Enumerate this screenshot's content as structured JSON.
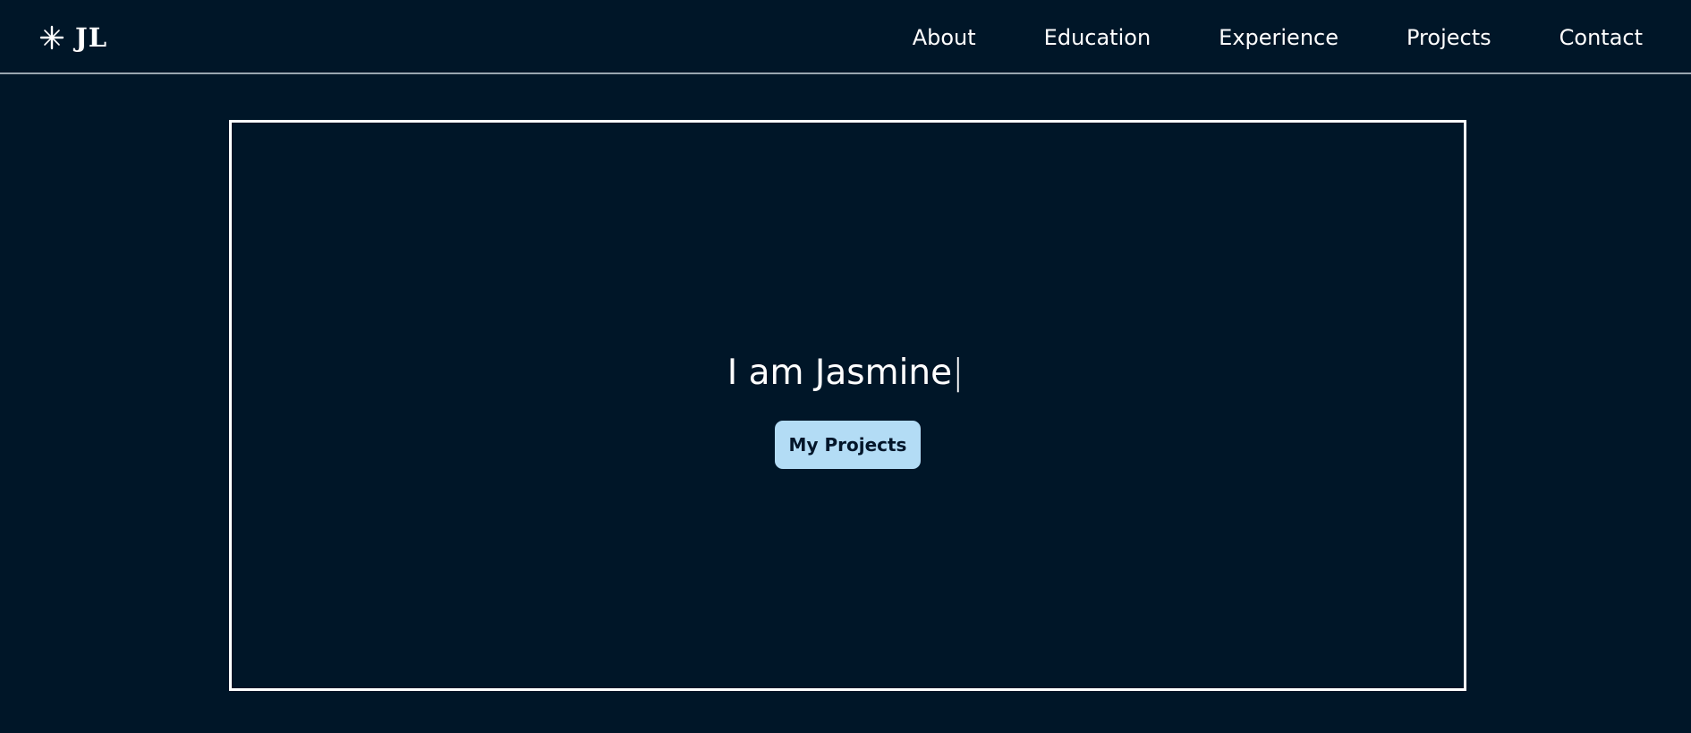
{
  "header": {
    "logo_text": "JL",
    "logo_icon": "sparkle-star-icon",
    "nav_items": [
      {
        "label": "About"
      },
      {
        "label": "Education"
      },
      {
        "label": "Experience"
      },
      {
        "label": "Projects"
      },
      {
        "label": "Contact"
      }
    ]
  },
  "hero": {
    "headline": "I am Jasmine",
    "cursor": "|",
    "button_label": "My Projects"
  },
  "colors": {
    "background": "#001628",
    "text": "#ffffff",
    "button_bg": "#b3dcf5",
    "button_text": "#03162a",
    "frame_border": "#ffffff",
    "header_divider": "#9aa6b0"
  }
}
